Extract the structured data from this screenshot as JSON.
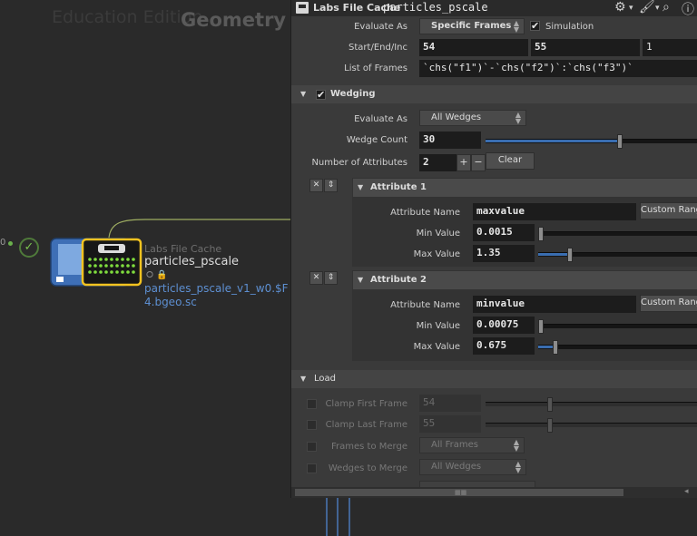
{
  "network": {
    "watermark": "Education Edition",
    "context": "Geometry",
    "left_num": "0",
    "node": {
      "type_label": "Labs File Cache",
      "name": "particles_pscale",
      "flags": "⭘ 🔒",
      "path": "particles_pscale_v1_w0.$F4.bgeo.sc"
    }
  },
  "pane": {
    "header": {
      "type": "Labs File Cache",
      "name": "particles_pscale"
    },
    "evaluate_as": {
      "label": "Evaluate As",
      "value": "Specific Frames",
      "simulation_label": "Simulation",
      "simulation_checked": true
    },
    "start_end_inc": {
      "label": "Start/End/Inc",
      "start": "54",
      "end": "55",
      "inc": "1"
    },
    "list_of_frames": {
      "label": "List of Frames",
      "value": "`chs(\"f1\")`-`chs(\"f2\")`:`chs(\"f3\")`"
    },
    "wedging": {
      "title": "Wedging",
      "checked": true,
      "evaluate_as_label": "Evaluate As",
      "evaluate_as_value": "All Wedges",
      "wedge_count_label": "Wedge Count",
      "wedge_count": "30",
      "wedge_count_fraction": 0.62,
      "num_attrs_label": "Number of Attributes",
      "num_attrs": "2",
      "plus": "+",
      "minus": "−",
      "clear_label": "Clear",
      "attributes": [
        {
          "title": "Attribute 1",
          "name_label": "Attribute Name",
          "name": "maxvalue",
          "custom_btn": "Custom Range",
          "min_label": "Min Value",
          "min": "0.0015",
          "min_fraction": 0.0,
          "max_label": "Max Value",
          "max": "1.35",
          "max_fraction": 0.18
        },
        {
          "title": "Attribute 2",
          "name_label": "Attribute Name",
          "name": "minvalue",
          "custom_btn": "Custom Range",
          "min_label": "Min Value",
          "min": "0.00075",
          "min_fraction": 0.0,
          "max_label": "Max Value",
          "max": "0.675",
          "max_fraction": 0.09
        }
      ]
    },
    "load": {
      "title": "Load",
      "clamp_first_label": "Clamp First Frame",
      "clamp_first": "54",
      "clamp_last_label": "Clamp Last Frame",
      "clamp_last": "55",
      "frames_to_merge_label": "Frames to Merge",
      "frames_to_merge": "All Frames",
      "wedges_to_merge_label": "Wedges to Merge",
      "wedges_to_merge": "All Wedges"
    }
  }
}
